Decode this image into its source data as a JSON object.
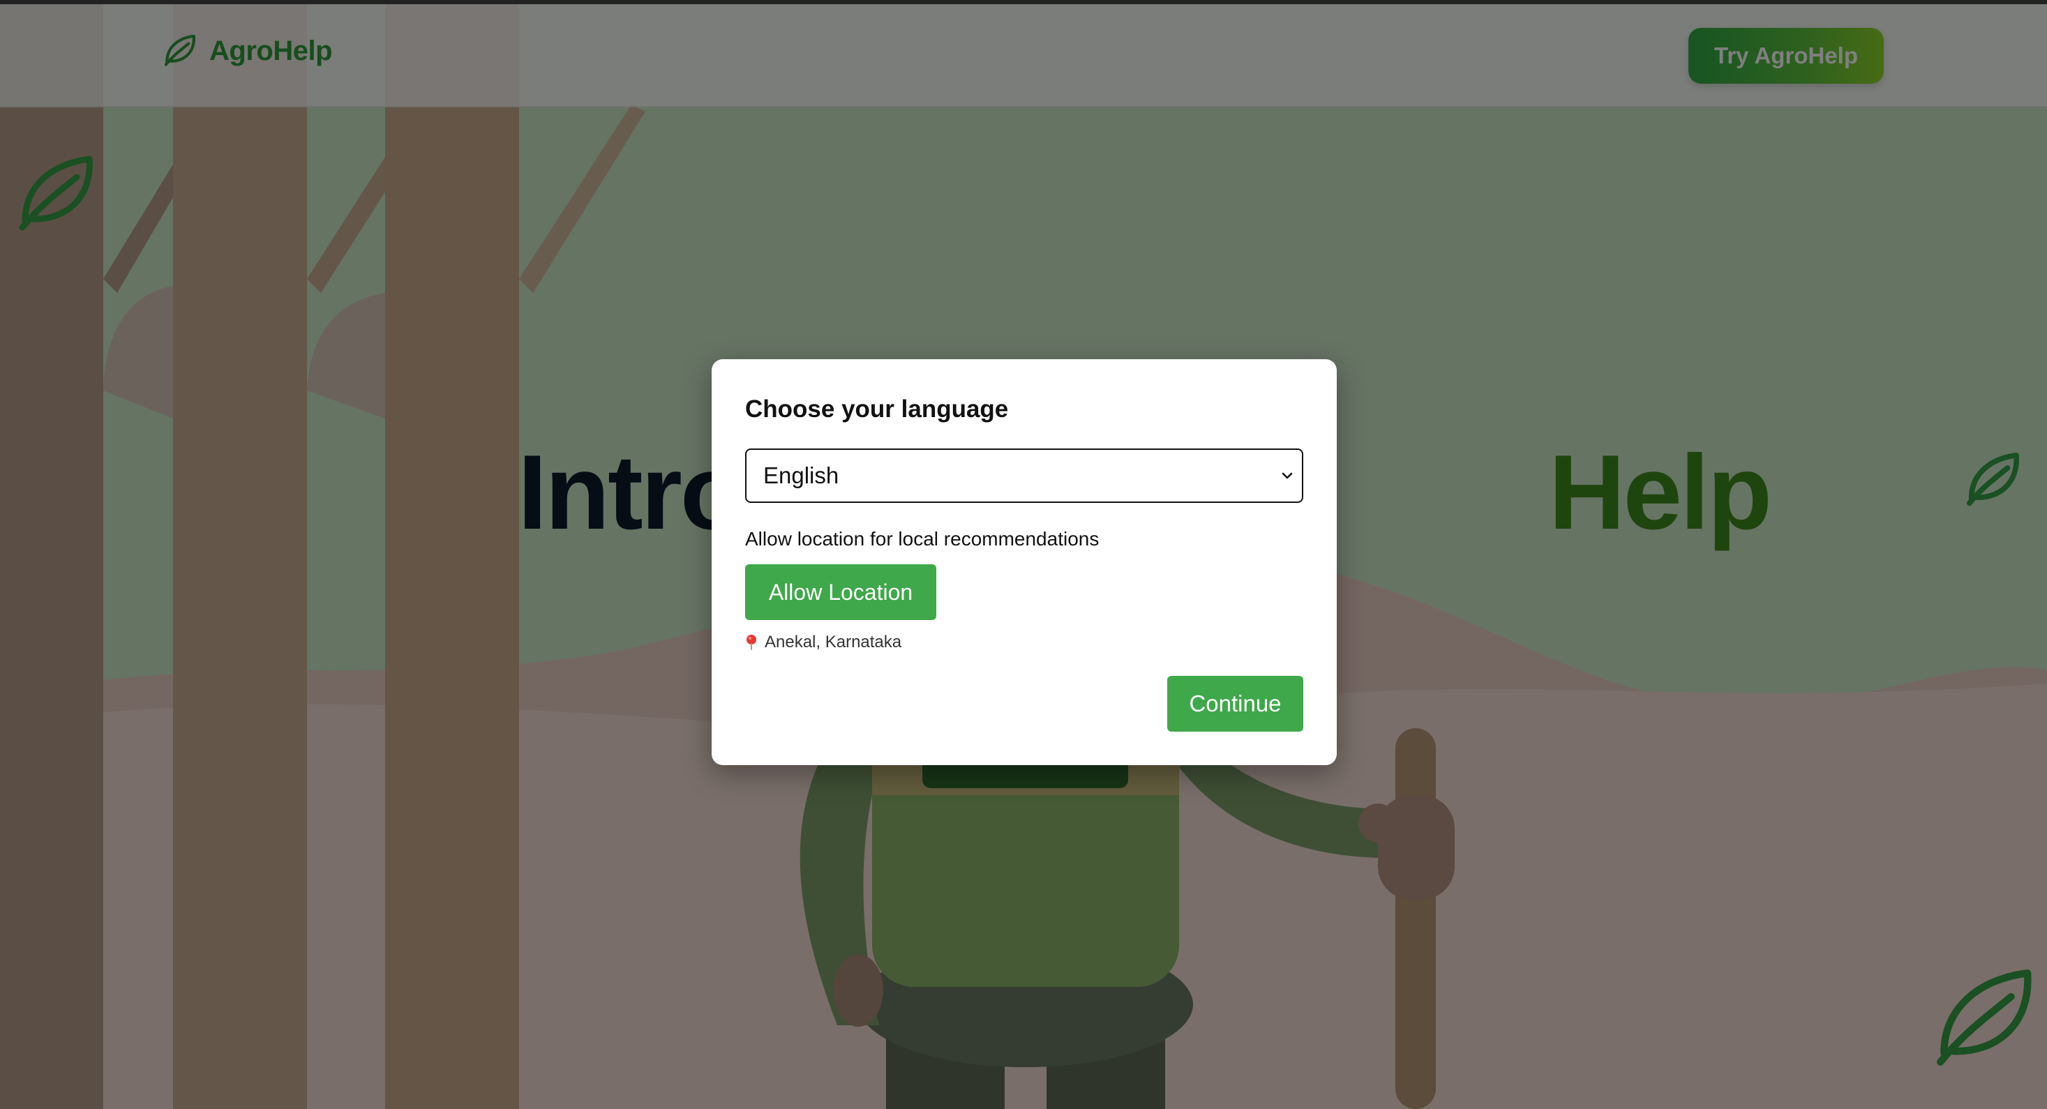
{
  "header": {
    "brand_name": "AgroHelp",
    "cta_label": "Try AgroHelp"
  },
  "hero": {
    "title_start": "Intro",
    "title_end": "Help"
  },
  "modal": {
    "title": "Choose your language",
    "language_selected": "English",
    "location_prompt": "Allow location for local recommendations",
    "allow_location_label": "Allow Location",
    "detected_location": "Anekal, Karnataka",
    "continue_label": "Continue"
  },
  "colors": {
    "brand_green": "#2e9a3a",
    "button_green": "#3fa84a",
    "cta_gradient_end": "#8fd629",
    "hero_dark": "#0d1b2a",
    "hero_green": "#3f8a1c"
  },
  "icons": {
    "brand": "leaf-icon",
    "decor": "leaf-icon",
    "select": "chevron-down-icon",
    "location": "map-pin-icon"
  }
}
